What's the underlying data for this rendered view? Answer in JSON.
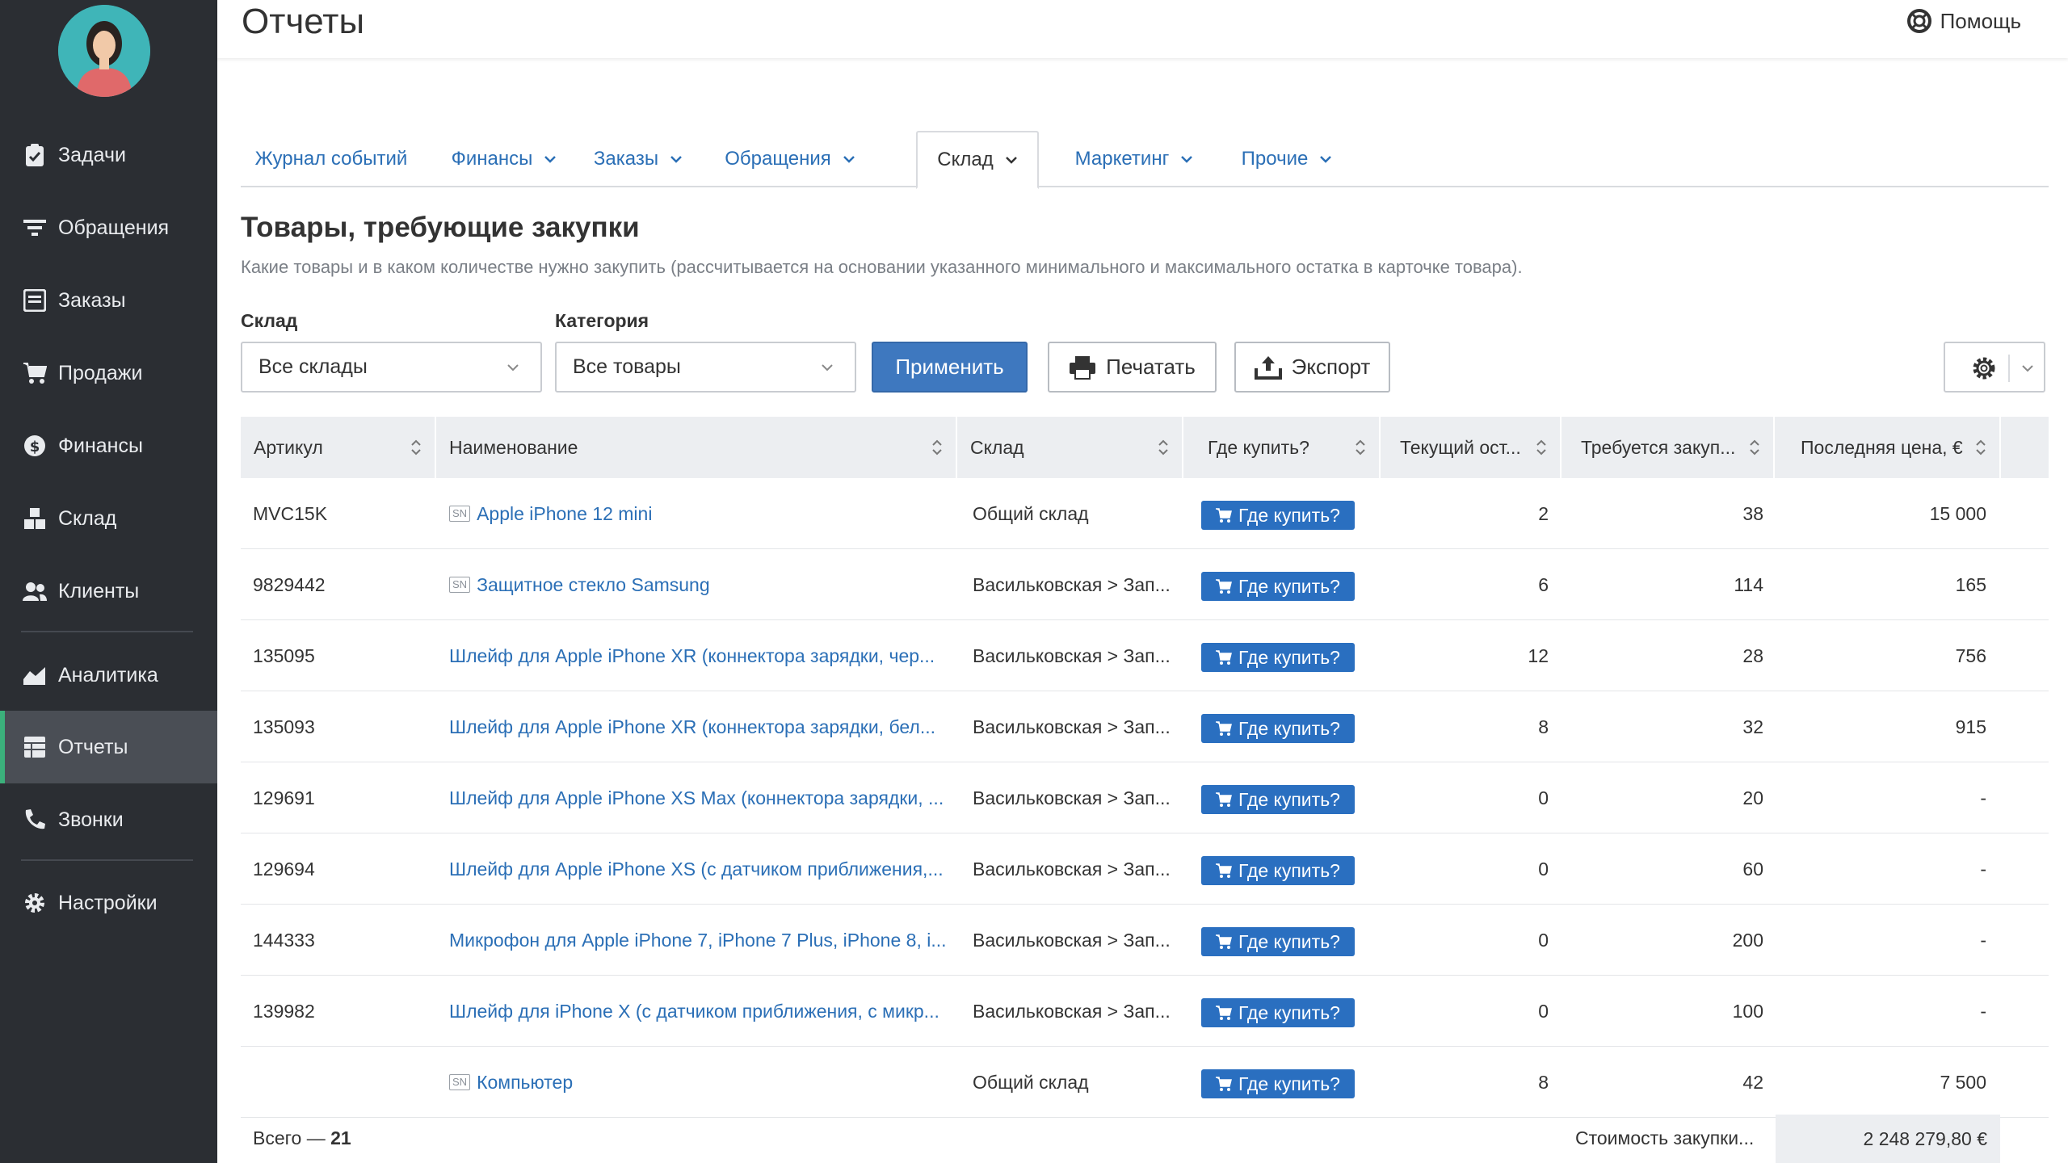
{
  "sidebar": {
    "items": [
      {
        "label": "Задачи",
        "icon": "clipboard-check-icon"
      },
      {
        "label": "Обращения",
        "icon": "filter-lines-icon"
      },
      {
        "label": "Заказы",
        "icon": "list-box-icon"
      },
      {
        "label": "Продажи",
        "icon": "cart-icon"
      },
      {
        "label": "Финансы",
        "icon": "dollar-circle-icon"
      },
      {
        "label": "Склад",
        "icon": "boxes-icon"
      },
      {
        "label": "Клиенты",
        "icon": "users-icon"
      },
      {
        "label": "Аналитика",
        "icon": "area-chart-icon"
      },
      {
        "label": "Отчеты",
        "icon": "table-icon",
        "active": true
      },
      {
        "label": "Звонки",
        "icon": "phone-icon"
      },
      {
        "label": "Настройки",
        "icon": "gear-icon"
      }
    ]
  },
  "header": {
    "title": "Отчеты",
    "help_label": "Помощь"
  },
  "tabs": [
    {
      "label": "Журнал событий"
    },
    {
      "label": "Финансы"
    },
    {
      "label": "Заказы"
    },
    {
      "label": "Обращения"
    },
    {
      "label": "Склад",
      "active": true
    },
    {
      "label": "Маркетинг"
    },
    {
      "label": "Прочие"
    }
  ],
  "report": {
    "title": "Товары, требующие закупки",
    "description": "Какие товары и в каком количестве нужно закупить (рассчитывается на основании указанного минимального и максимального остатка в карточке товара)."
  },
  "filters": {
    "warehouse_label": "Склад",
    "warehouse_value": "Все склады",
    "category_label": "Категория",
    "category_value": "Все товары",
    "apply_label": "Применить",
    "print_label": "Печатать",
    "export_label": "Экспорт"
  },
  "table": {
    "columns": [
      "Артикул",
      "Наименование",
      "Склад",
      "Где купить?",
      "Текущий ост...",
      "Требуется закуп...",
      "Последняя цена, €"
    ],
    "buy_label": "Где купить?",
    "sn_label": "SN",
    "rows": [
      {
        "sku": "MVC15K",
        "name": "Apple iPhone 12 mini",
        "sn": true,
        "warehouse": "Общий склад",
        "stock": "2",
        "required": "38",
        "price": "15 000"
      },
      {
        "sku": "9829442",
        "name": "Защитное стекло Samsung",
        "sn": true,
        "warehouse": "Васильковская > Зап...",
        "stock": "6",
        "required": "114",
        "price": "165"
      },
      {
        "sku": "135095",
        "name": "Шлейф для Apple iPhone XR (коннектора зарядки, чер...",
        "sn": false,
        "warehouse": "Васильковская > Зап...",
        "stock": "12",
        "required": "28",
        "price": "756"
      },
      {
        "sku": "135093",
        "name": "Шлейф для Apple iPhone XR (коннектора зарядки, бел...",
        "sn": false,
        "warehouse": "Васильковская > Зап...",
        "stock": "8",
        "required": "32",
        "price": "915"
      },
      {
        "sku": "129691",
        "name": "Шлейф для Apple iPhone XS Max (коннектора зарядки, ...",
        "sn": false,
        "warehouse": "Васильковская > Зап...",
        "stock": "0",
        "required": "20",
        "price": "-"
      },
      {
        "sku": "129694",
        "name": "Шлейф для Apple iPhone XS (с датчиком приближения,...",
        "sn": false,
        "warehouse": "Васильковская > Зап...",
        "stock": "0",
        "required": "60",
        "price": "-"
      },
      {
        "sku": "144333",
        "name": "Микрофон для Apple iPhone 7, iPhone 7 Plus, iPhone 8, i...",
        "sn": false,
        "warehouse": "Васильковская > Зап...",
        "stock": "0",
        "required": "200",
        "price": "-"
      },
      {
        "sku": "139982",
        "name": "Шлейф для iPhone X (с датчиком приближения, с микр...",
        "sn": false,
        "warehouse": "Васильковская > Зап...",
        "stock": "0",
        "required": "100",
        "price": "-"
      },
      {
        "sku": "",
        "name": "Компьютер",
        "sn": true,
        "warehouse": "Общий склад",
        "stock": "8",
        "required": "42",
        "price": "7 500"
      }
    ]
  },
  "footer": {
    "total_label": "Всего — ",
    "total_count": "21",
    "cost_label": "Стоимость закупки...",
    "cost_value": "2 248 279,80 €"
  },
  "colors": {
    "sidebar_bg": "#2b2e33",
    "active_accent": "#3bb07b",
    "link": "#2b6fb6",
    "primary": "#3e78bf",
    "buy_button": "#2a6fc0"
  }
}
